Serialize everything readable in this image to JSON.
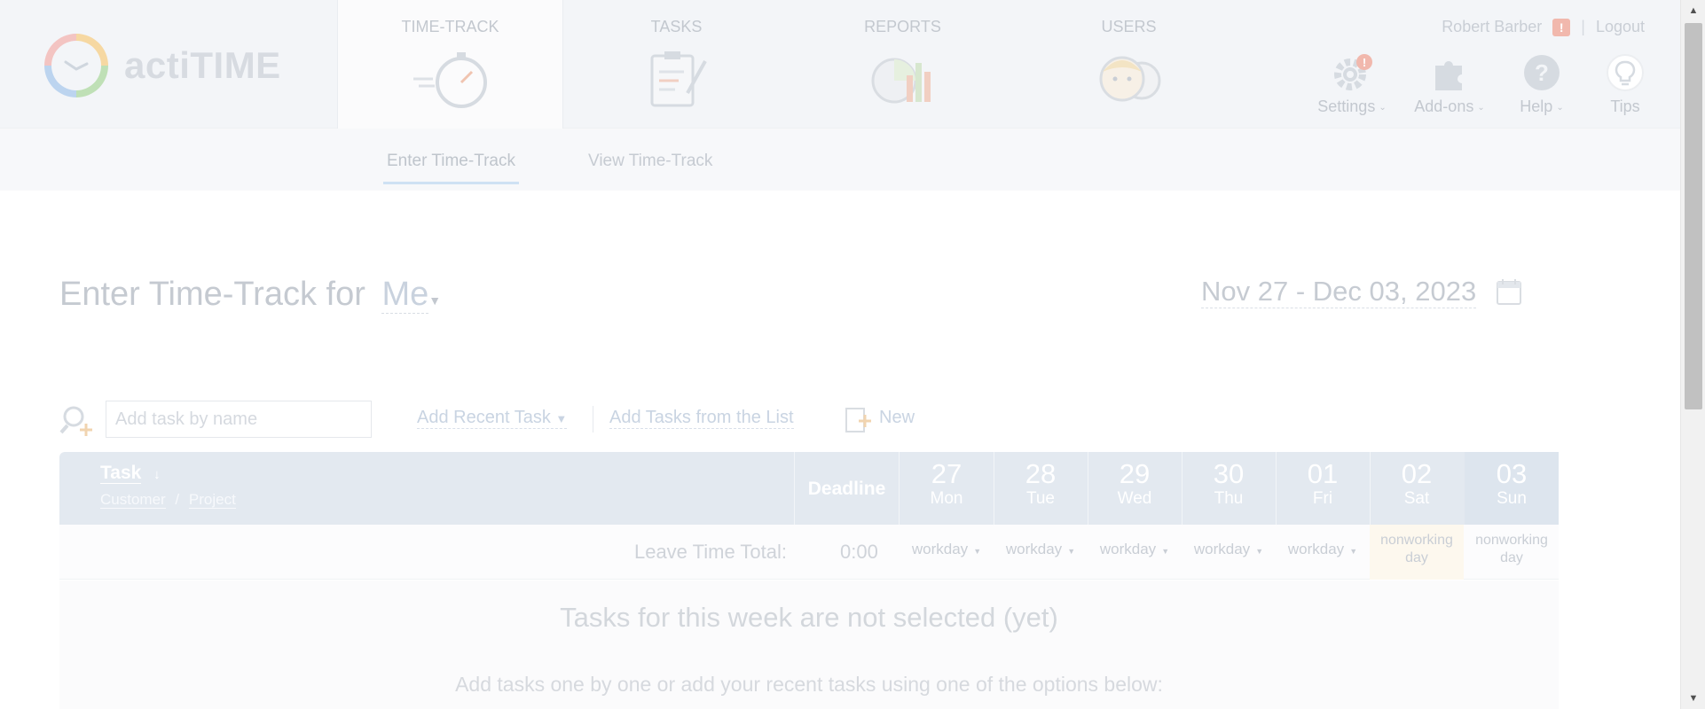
{
  "app": {
    "logo_text": "actiTIME"
  },
  "nav": {
    "tabs": [
      {
        "label": "TIME-TRACK",
        "icon": "stopwatch-icon",
        "active": true
      },
      {
        "label": "TASKS",
        "icon": "clipboard-icon",
        "active": false
      },
      {
        "label": "REPORTS",
        "icon": "pie-bar-chart-icon",
        "active": false
      },
      {
        "label": "USERS",
        "icon": "users-icon",
        "active": false
      }
    ]
  },
  "user": {
    "name": "Robert Barber",
    "badge": "!",
    "logout": "Logout"
  },
  "tools": [
    {
      "label": "Settings",
      "icon": "gear-icon",
      "badge": "!"
    },
    {
      "label": "Add-ons",
      "icon": "puzzle-icon"
    },
    {
      "label": "Help",
      "icon": "question-icon"
    },
    {
      "label": "Tips",
      "icon": "lightbulb-icon"
    }
  ],
  "subnav": {
    "enter": "Enter Time-Track",
    "view": "View Time-Track"
  },
  "header": {
    "title_prefix": "Enter Time-Track for",
    "who": "Me",
    "date_range": "Nov 27 - Dec 03, 2023"
  },
  "add_task": {
    "placeholder": "Add task by name",
    "recent": "Add Recent Task",
    "from_list": "Add Tasks from the List",
    "new": "New"
  },
  "table": {
    "task_header": "Task",
    "customer": "Customer",
    "slash": "/",
    "project": "Project",
    "deadline": "Deadline",
    "days": [
      {
        "date": "27",
        "weekday": "Mon",
        "status": "workday"
      },
      {
        "date": "28",
        "weekday": "Tue",
        "status": "workday"
      },
      {
        "date": "29",
        "weekday": "Wed",
        "status": "workday"
      },
      {
        "date": "30",
        "weekday": "Thu",
        "status": "workday"
      },
      {
        "date": "01",
        "weekday": "Fri",
        "status": "workday"
      },
      {
        "date": "02",
        "weekday": "Sat",
        "status": "nonworking day"
      },
      {
        "date": "03",
        "weekday": "Sun",
        "status": "nonworking day"
      }
    ],
    "leave_label": "Leave Time Total:",
    "leave_total": "0:00"
  },
  "empty_state": {
    "title": "Tasks for this week are not selected (yet)",
    "subtitle": "Add tasks one by one or add your recent tasks using one of the options below:"
  }
}
